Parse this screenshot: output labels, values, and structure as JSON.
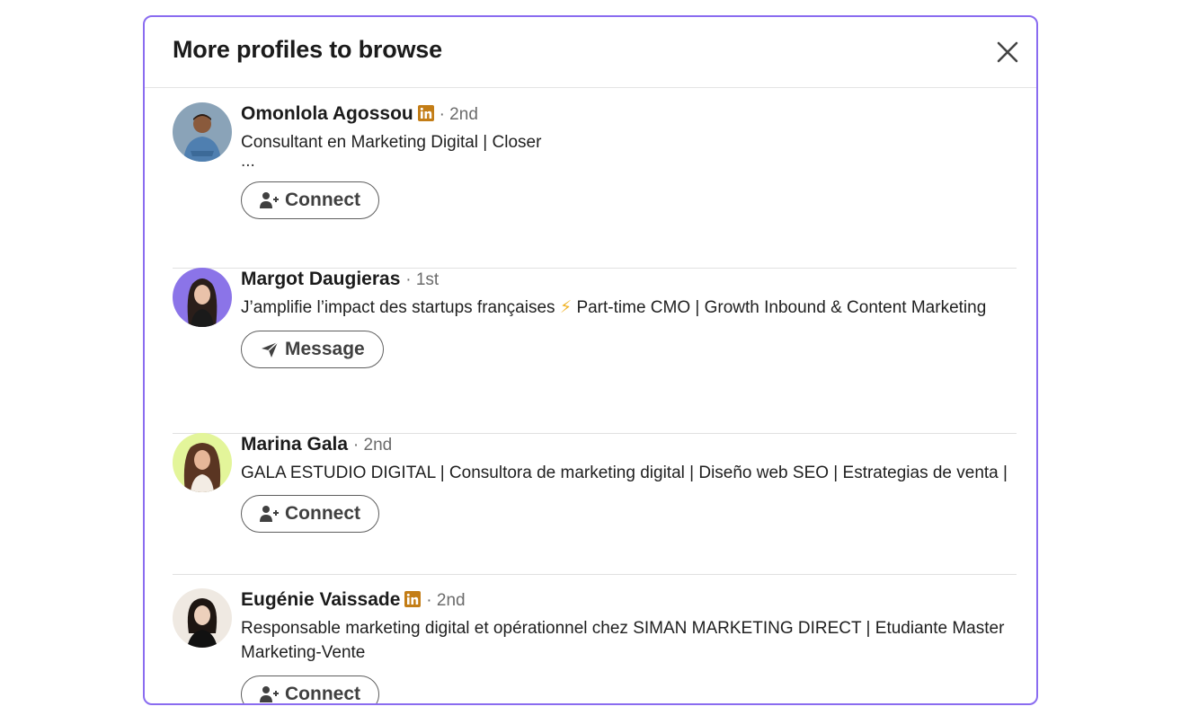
{
  "modal": {
    "title": "More profiles to browse",
    "close_icon": "close-icon",
    "accent": "#8a6cf0"
  },
  "profiles": [
    {
      "name": "Omonlola Agossou",
      "badge": "linkedin-premium-icon",
      "degree": "· 2nd",
      "headline": "Consultant en Marketing Digital | Closer",
      "more": "...",
      "action": "Connect",
      "action_icon": "add-person-icon"
    },
    {
      "name": "Margot Daugieras",
      "degree": "· 1st",
      "headline_part1": "J’amplifie l’impact des startups françaises",
      "headline_emoji": "⚡",
      "headline_part2": "Part-time CMO | Growth Inbound & Content Marketing",
      "action": "Message",
      "action_icon": "send-icon"
    },
    {
      "name": "Marina Gala",
      "degree": "· 2nd",
      "headline": "GALA ESTUDIO DIGITAL | Consultora de marketing digital | Diseño web SEO | Estrategias de venta |",
      "action": "Connect",
      "action_icon": "add-person-icon"
    },
    {
      "name": "Eugénie Vaissade",
      "badge": "linkedin-premium-icon",
      "degree": "· 2nd",
      "headline": "Responsable marketing digital et opérationnel chez SIMAN MARKETING DIRECT | Etudiante Master Marketing-Vente",
      "action": "Connect",
      "action_icon": "add-person-icon"
    }
  ]
}
